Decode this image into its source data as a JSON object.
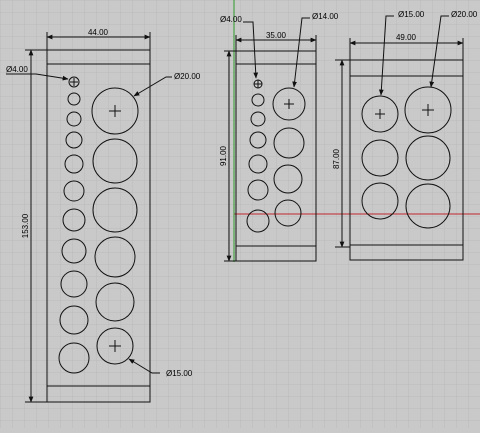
{
  "viewport": {
    "colors": {
      "background": "#c9c9c9",
      "grid": "#b6b6b6",
      "geometry": "#111111",
      "x_axis": "#c0262d",
      "y_axis": "#2a9a2a"
    }
  },
  "holder_left": {
    "width_dim": "44.00",
    "height_dim": "153.00",
    "small_hole_callout": "Ø4.00",
    "large_hole_callout": "Ø20.00",
    "bottom_hole_callout": "Ø15.00"
  },
  "holder_middle": {
    "width_dim": "35.00",
    "height_dim": "91.00",
    "small_hole_callout": "Ø4.00",
    "large_hole_callout": "Ø14.00"
  },
  "holder_right": {
    "width_dim": "49.00",
    "height_dim": "87.00",
    "left_hole_callout": "Ø15.00",
    "right_hole_callout": "Ø20.00"
  }
}
